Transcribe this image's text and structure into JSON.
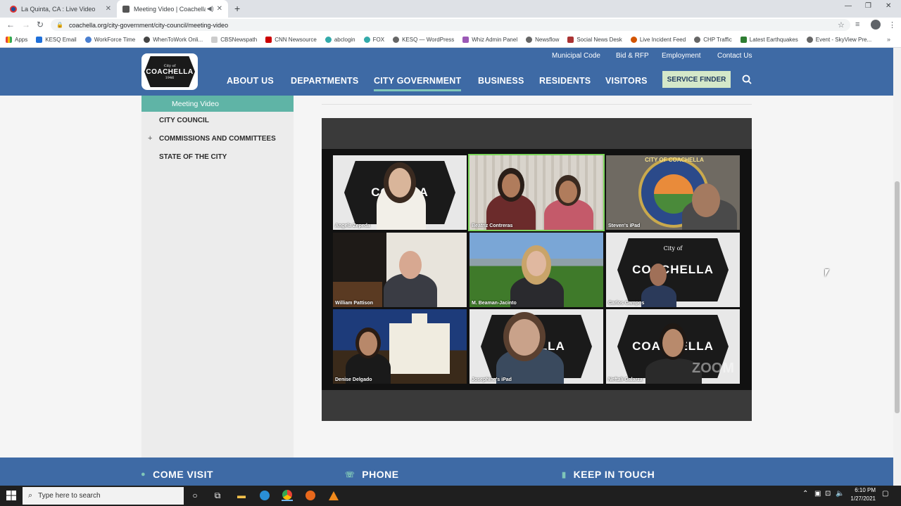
{
  "browser": {
    "tabs": [
      {
        "title": "La Quinta, CA : Live Video",
        "active": false
      },
      {
        "title": "Meeting Video | Coachella, C",
        "active": true
      }
    ],
    "url": "coachella.org/city-government/city-council/meeting-video",
    "bookmarks": [
      "Apps",
      "KESQ Email",
      "WorkForce Time",
      "WhenToWork Onli...",
      "CBSNewspath",
      "CNN Newsource",
      "abclogin",
      "FOX",
      "KESQ — WordPress",
      "Whiz Admin Panel",
      "Newsflow",
      "Social News Desk",
      "Live Incident Feed",
      "CHP Traffic",
      "Latest Earthquakes",
      "Event - SkyView Pre..."
    ]
  },
  "site": {
    "logo_top": "City of",
    "logo_word": "COACHELLA",
    "logo_year": "1946",
    "util_nav": [
      "Municipal Code",
      "Bid & RFP",
      "Employment",
      "Contact Us"
    ],
    "main_nav": [
      "ABOUT US",
      "DEPARTMENTS",
      "CITY GOVERNMENT",
      "BUSINESS",
      "RESIDENTS",
      "VISITORS"
    ],
    "service_finder": "SERVICE FINDER"
  },
  "sidebar": {
    "active": "Meeting Video",
    "items": [
      "CITY COUNCIL",
      "COMMISSIONS AND COMMITTEES",
      "STATE OF THE CITY"
    ]
  },
  "video": {
    "participants": [
      "Angela Zepeda",
      "Beatriz Contreras",
      "Steven's iPad",
      "William Pattison",
      "M. Beaman-Jacinto",
      "Carlos Campos",
      "Denise Delgado",
      "Josephine's iPad",
      "Neftali Galarza"
    ],
    "badge_word_partial": "CO   ELLA",
    "watermark": "ZOOM",
    "seal_text": "CITY OF COACHELLA"
  },
  "footer": {
    "sections": [
      "COME VISIT",
      "PHONE",
      "KEEP IN TOUCH"
    ]
  },
  "taskbar": {
    "search_placeholder": "Type here to search",
    "time": "6:10 PM",
    "date": "1/27/2021"
  }
}
